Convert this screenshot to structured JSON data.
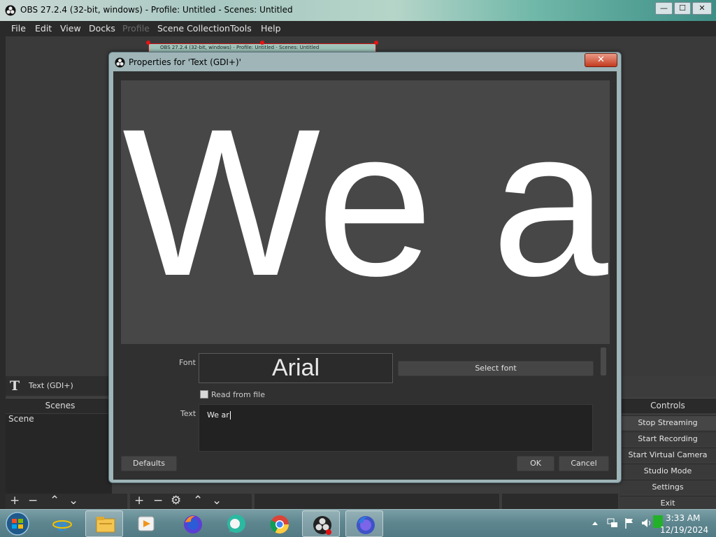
{
  "window": {
    "title": "OBS 27.2.4 (32-bit, windows) - Profile: Untitled - Scenes: Untitled",
    "controls": {
      "minimize": "—",
      "maximize": "☐",
      "close": "✕"
    }
  },
  "menu": [
    "File",
    "Edit",
    "View",
    "Docks",
    "Profile",
    "Scene Collection",
    "Tools",
    "Help"
  ],
  "mini_preview_title": "OBS 27.2.4 (32-bit, windows) - Profile: Untitled - Scenes: Untitled",
  "sources": {
    "selected_label": "Text (GDI+)"
  },
  "scenes": {
    "header": "Scenes",
    "items": [
      "Scene"
    ]
  },
  "controls": {
    "header": "Controls",
    "buttons": [
      "Stop Streaming",
      "Start Recording",
      "Start Virtual Camera",
      "Studio Mode",
      "Settings",
      "Exit"
    ]
  },
  "dialog": {
    "title": "Properties for 'Text (GDI+)'",
    "close_label": "✕",
    "preview_text": "We a",
    "font_label": "Font",
    "font_name": "Arial",
    "select_font_label": "Select font",
    "read_from_file_label": "Read from file",
    "read_from_file_checked": false,
    "text_label": "Text",
    "text_value": "We ar",
    "defaults_label": "Defaults",
    "ok_label": "OK",
    "cancel_label": "Cancel"
  },
  "taskbar": {
    "apps": [
      "start-orb",
      "internet-explorer-icon",
      "file-explorer-icon",
      "media-player-icon",
      "firefox-icon",
      "chat-app-icon",
      "chrome-icon",
      "obs-icon",
      "firefox-alt-icon"
    ],
    "time": "3:33 AM",
    "date": "12/19/2024"
  },
  "colors": {
    "dark_bg": "#2a2a2a",
    "panel_bg": "#3a3a3a",
    "preview_bg": "#474747",
    "dialog_frame": "#9fb5b8",
    "close_red": "#c43b1e",
    "taskbar": "#5f8790"
  }
}
